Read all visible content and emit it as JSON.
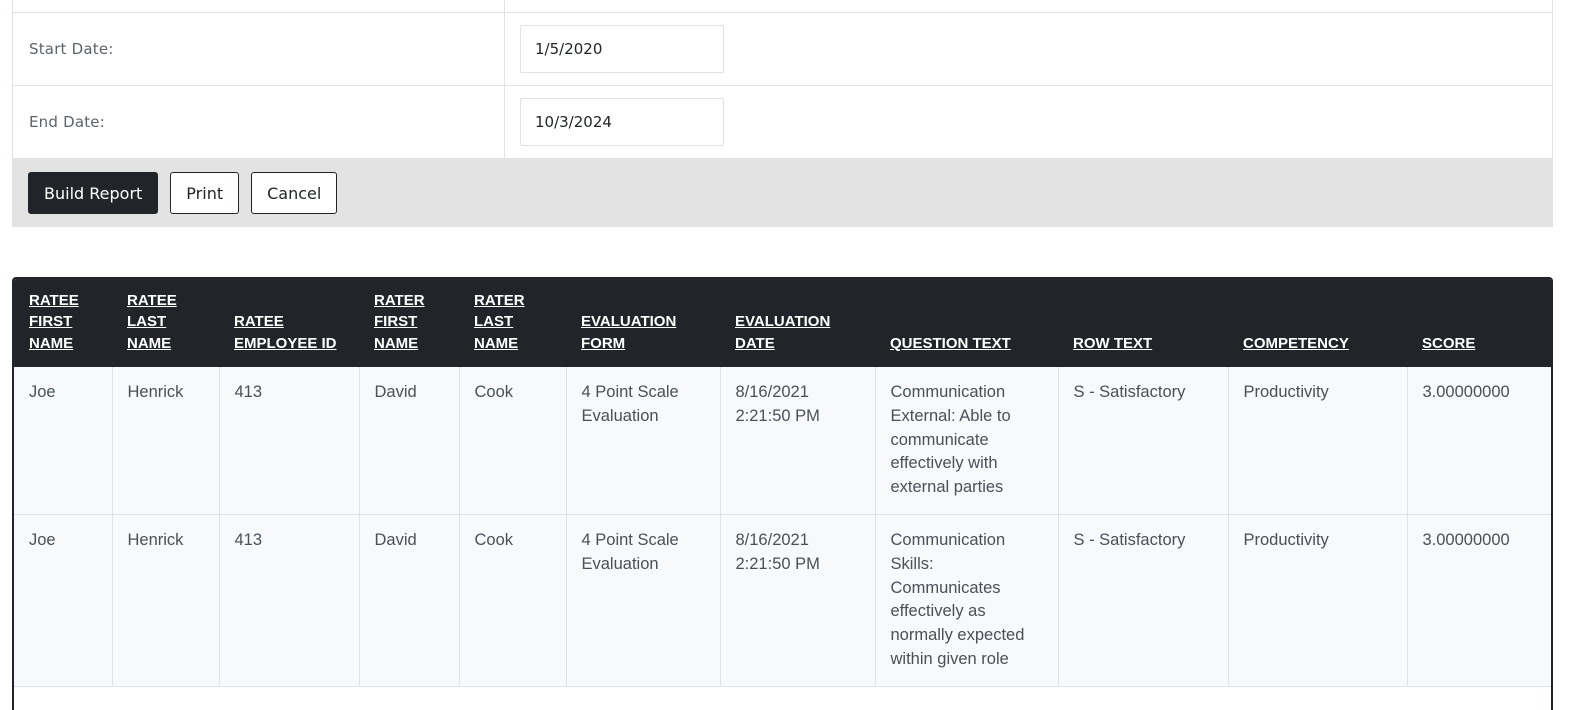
{
  "form": {
    "start_date_label": "Start Date:",
    "start_date_value": "1/5/2020",
    "end_date_label": "End Date:",
    "end_date_value": "10/3/2024"
  },
  "actions": {
    "build_report_label": "Build Report",
    "print_label": "Print",
    "cancel_label": "Cancel"
  },
  "table": {
    "headers": [
      "RATEE FIRST NAME",
      "RATEE LAST NAME",
      "RATEE EMPLOYEE ID",
      "RATER FIRST NAME",
      "RATER LAST NAME",
      "EVALUATION FORM",
      "EVALUATION DATE",
      "QUESTION TEXT",
      "ROW TEXT",
      "COMPETENCY",
      "SCORE"
    ],
    "rows": [
      {
        "ratee_first": "Joe",
        "ratee_last": "Henrick",
        "employee_id": "413",
        "rater_first": "David",
        "rater_last": "Cook",
        "form": "4 Point Scale Evaluation",
        "date": "8/16/2021 2:21:50 PM",
        "question": "Communication External: Able to communicate effectively with external parties",
        "row_text": "S - Satisfactory",
        "competency": "Productivity",
        "score": "3.00000000"
      },
      {
        "ratee_first": "Joe",
        "ratee_last": "Henrick",
        "employee_id": "413",
        "rater_first": "David",
        "rater_last": "Cook",
        "form": "4 Point Scale Evaluation",
        "date": "8/16/2021 2:21:50 PM",
        "question": "Communication Skills: Communicates effectively as normally expected within  given role",
        "row_text": "S - Satisfactory",
        "competency": "Productivity",
        "score": "3.00000000"
      }
    ]
  }
}
